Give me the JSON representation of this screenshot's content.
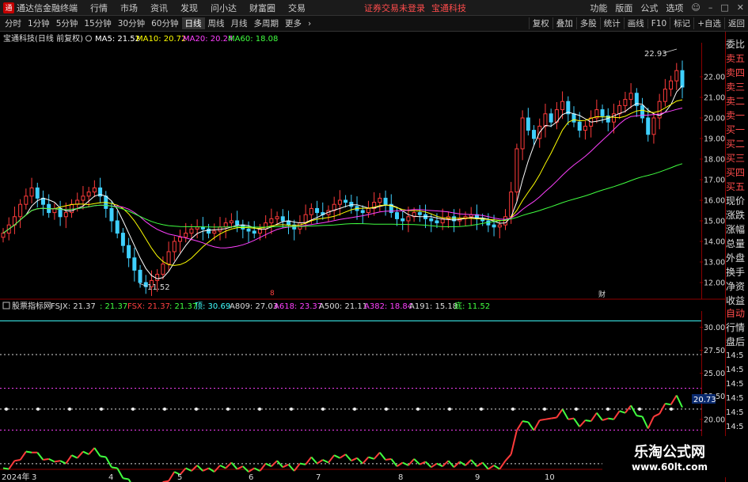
{
  "menubar": {
    "app_title": "通达信金融终端",
    "items": [
      "行情",
      "市场",
      "资讯",
      "发现",
      "问小达",
      "财富圈",
      "交易"
    ],
    "notice": "证券交易未登录",
    "stock": "宝通科技",
    "right_items": [
      "功能",
      "版面",
      "公式",
      "选项"
    ],
    "guest": "游客"
  },
  "toolbar": {
    "periods": [
      "分时",
      "1分钟",
      "5分钟",
      "15分钟",
      "30分钟",
      "60分钟",
      "日线",
      "周线",
      "月线",
      "多周期",
      "更多"
    ],
    "active_period": "日线",
    "buttons": [
      "复权",
      "叠加",
      "多股",
      "统计",
      "画线",
      "F10",
      "标记",
      "+自选",
      "返回"
    ]
  },
  "main_header": {
    "title": "宝通科技(日线 前复权)",
    "ma": [
      {
        "label": "MA5: 21.52",
        "color": "#ffffff"
      },
      {
        "label": "MA10: 20.72",
        "color": "#ffff00"
      },
      {
        "label": "MA20: 20.24",
        "color": "#ff40ff"
      },
      {
        "label": "MA60: 18.08",
        "color": "#40ff40"
      }
    ]
  },
  "price_axis": [
    "22.00",
    "21.00",
    "20.00",
    "19.00",
    "18.00",
    "17.00",
    "16.00",
    "15.00",
    "14.00",
    "13.00",
    "12.00"
  ],
  "annotations": {
    "high": "22.93",
    "low": "11.52",
    "event_a": "8",
    "event_b": "财"
  },
  "indicator_header": {
    "name": "股票指标网",
    "items": [
      {
        "label": "FSJX: 21.37",
        "color": "#dddddd"
      },
      {
        "label": ": 21.37",
        "color": "#40ff40"
      },
      {
        "label": "FSX: 21.37",
        "color": "#ff4040"
      },
      {
        "label": ": 21.37",
        "color": "#40ff40"
      },
      {
        "label": "顶: 30.69",
        "color": "#40ffff"
      },
      {
        "label": "A809: 27.03",
        "color": "#dddddd"
      },
      {
        "label": "A618: 23.37",
        "color": "#ff40ff"
      },
      {
        "label": "A500: 21.11",
        "color": "#dddddd"
      },
      {
        "label": "A382: 18.84",
        "color": "#ff40ff"
      },
      {
        "label": "A191: 15.18",
        "color": "#dddddd"
      },
      {
        "label": "底: 11.52",
        "color": "#40ff40"
      }
    ]
  },
  "indicator_axis": [
    "30.00",
    "27.50",
    "25.00",
    "22.50",
    "20.00",
    "17.50"
  ],
  "indicator_value": "20.73",
  "date_axis": [
    "2024年",
    "3",
    "4",
    "5",
    "6",
    "7",
    "8",
    "9",
    "10"
  ],
  "right_panel": [
    "委比",
    "卖五",
    "卖四",
    "卖三",
    "卖二",
    "卖一",
    "买一",
    "买二",
    "买三",
    "买四",
    "买五",
    "现价",
    "涨跌",
    "涨幅",
    "总量",
    "外盘",
    "换手",
    "净资",
    "收益"
  ],
  "right_panel_lower": [
    "自动",
    "行情",
    "盘后",
    "14:5",
    "14:5",
    "14:5",
    "14:5",
    "14:5",
    "14:5"
  ],
  "watermark": {
    "title": "乐淘公式网",
    "url": "www.60lt.com"
  },
  "colors": {
    "up": "#ff3b3b",
    "down": "#3fd0ff",
    "ma5": "#ffffff",
    "ma10": "#ffff00",
    "ma20": "#ff40ff",
    "ma60": "#40ff40",
    "menu_red": "#ff4c4c"
  },
  "chart_data": {
    "type": "candlestick",
    "y_range": [
      11.5,
      23.5
    ],
    "indicator_range": [
      15,
      31.5
    ],
    "closes": [
      14.4,
      14.8,
      15.2,
      15.8,
      16.2,
      16.6,
      16.1,
      15.8,
      15.4,
      15.6,
      15.2,
      15.4,
      15.8,
      16.0,
      16.2,
      16.4,
      16.6,
      16.2,
      15.6,
      15.0,
      14.4,
      13.8,
      13.2,
      12.6,
      12.0,
      11.8,
      12.1,
      12.4,
      12.9,
      13.5,
      14.0,
      14.2,
      14.4,
      14.6,
      14.7,
      14.6,
      14.4,
      14.5,
      14.7,
      14.9,
      15.0,
      14.8,
      14.6,
      14.5,
      14.4,
      14.6,
      14.9,
      15.1,
      15.2,
      15.0,
      14.8,
      14.6,
      14.9,
      15.3,
      15.6,
      15.4,
      15.3,
      15.5,
      15.8,
      16.0,
      15.9,
      15.7,
      15.5,
      15.4,
      15.6,
      15.9,
      16.1,
      15.8,
      15.4,
      15.1,
      15.0,
      15.2,
      15.4,
      15.3,
      15.1,
      15.0,
      14.9,
      15.1,
      15.2,
      15.0,
      15.1,
      15.2,
      15.3,
      15.1,
      15.0,
      14.8,
      14.7,
      14.8,
      15.2,
      16.4,
      18.5,
      20.0,
      19.4,
      19.0,
      19.6,
      20.2,
      19.8,
      20.4,
      20.8,
      20.2,
      19.8,
      19.4,
      19.6,
      20.0,
      20.4,
      20.1,
      19.8,
      20.2,
      20.6,
      20.9,
      21.2,
      20.6,
      20.0,
      19.2,
      20.0,
      20.8,
      21.4,
      21.8,
      22.3,
      21.5
    ]
  }
}
